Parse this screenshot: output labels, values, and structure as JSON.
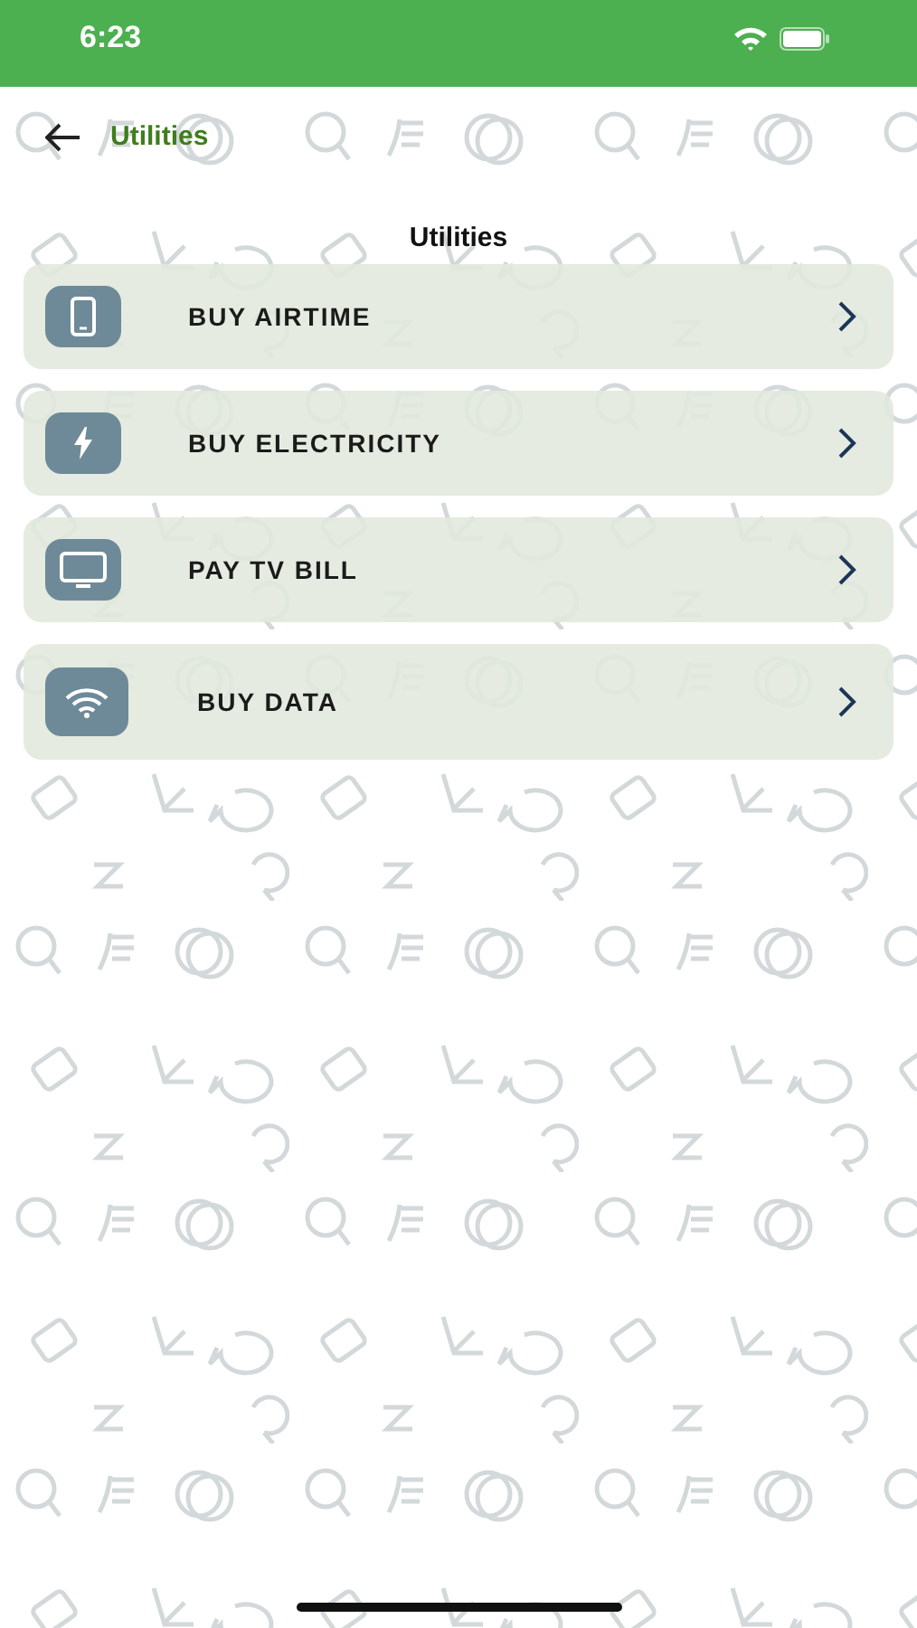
{
  "status_bar": {
    "time": "6:23"
  },
  "header": {
    "title": "Utilities"
  },
  "section_title": "Utilities",
  "items": [
    {
      "label": "BUY AIRTIME"
    },
    {
      "label": "BUY ELECTRICITY"
    },
    {
      "label": "PAY TV BILL"
    },
    {
      "label": "BUY DATA"
    }
  ]
}
